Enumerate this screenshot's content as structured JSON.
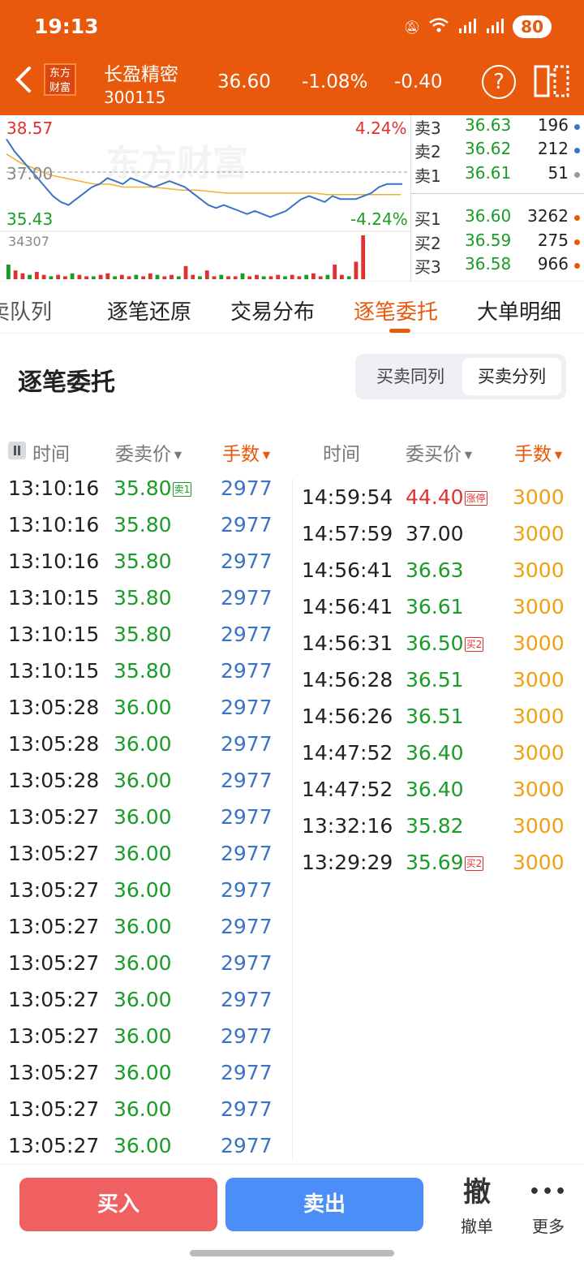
{
  "status": {
    "time": "19:13",
    "battery": "80"
  },
  "header": {
    "logo_line1": "东方",
    "logo_line2": "财富",
    "stock_name": "长盈精密",
    "stock_code": "300115",
    "price": "36.60",
    "change_pct": "-1.08%",
    "change": "-0.40"
  },
  "chart": {
    "high_price": "38.57",
    "prev_close": "37.00",
    "low_price": "35.43",
    "high_pct": "4.24%",
    "low_pct": "-4.24%",
    "volume_max": "34307",
    "watermark": "东方财富",
    "price_line": [
      38.1,
      37.7,
      37.4,
      37.1,
      36.8,
      36.5,
      36.2,
      36.0,
      35.9,
      36.1,
      36.3,
      36.5,
      36.6,
      36.8,
      36.7,
      36.6,
      36.8,
      36.7,
      36.6,
      36.5,
      36.6,
      36.7,
      36.6,
      36.5,
      36.3,
      36.1,
      35.9,
      35.8,
      35.9,
      35.8,
      35.7,
      35.6,
      35.7,
      35.6,
      35.5,
      35.6,
      35.7,
      35.9,
      36.1,
      36.2,
      36.1,
      36.0,
      36.2,
      36.1,
      36.1,
      36.1,
      36.2,
      36.3,
      36.5,
      36.6,
      36.6,
      36.6
    ],
    "avg_line": [
      37.6,
      37.3,
      37.1,
      36.9,
      36.8,
      36.7,
      36.6,
      36.6,
      36.5,
      36.5,
      36.5,
      36.45,
      36.4,
      36.4,
      36.35,
      36.3,
      36.3,
      36.3,
      36.3,
      36.3,
      36.3,
      36.3,
      36.25,
      36.25,
      36.25,
      36.25,
      36.25,
      36.25
    ],
    "volumes": [
      10,
      6,
      4,
      3,
      5,
      3,
      2,
      3,
      2,
      4,
      3,
      2,
      2,
      3,
      4,
      2,
      3,
      2,
      3,
      2,
      4,
      3,
      2,
      3,
      2,
      9,
      3,
      2,
      6,
      2,
      3,
      2,
      2,
      4,
      2,
      3,
      2,
      2,
      3,
      2,
      3,
      2,
      3,
      4,
      2,
      3,
      10,
      3,
      2,
      12,
      30
    ]
  },
  "orderbook": {
    "rows": [
      {
        "label": "卖3",
        "price": "36.63",
        "vol": "196",
        "dot": "#3b73c6"
      },
      {
        "label": "卖2",
        "price": "36.62",
        "vol": "212",
        "dot": "#3b73c6"
      },
      {
        "label": "卖1",
        "price": "36.61",
        "vol": "51",
        "dot": "#999999"
      },
      {
        "label": "买1",
        "price": "36.60",
        "vol": "3262",
        "dot": "#e8590c"
      },
      {
        "label": "买2",
        "price": "36.59",
        "vol": "275",
        "dot": "#e8590c"
      },
      {
        "label": "买3",
        "price": "36.58",
        "vol": "966",
        "dot": "#e8590c"
      }
    ]
  },
  "tabs": [
    "卖队列",
    "逐笔还原",
    "交易分布",
    "逐笔委托",
    "大单明细"
  ],
  "section": {
    "title": "逐笔委托",
    "toggle_same": "买卖同列",
    "toggle_split": "买卖分列"
  },
  "columns": {
    "left_time": "时间",
    "left_price": "委卖价",
    "left_vol": "手数",
    "right_time": "时间",
    "right_price": "委买价",
    "right_vol": "手数"
  },
  "sell_orders": [
    {
      "time": "13:10:16",
      "price": "35.80",
      "tag": "卖1",
      "vol": "2977"
    },
    {
      "time": "13:10:16",
      "price": "35.80",
      "tag": "",
      "vol": "2977"
    },
    {
      "time": "13:10:16",
      "price": "35.80",
      "tag": "",
      "vol": "2977"
    },
    {
      "time": "13:10:15",
      "price": "35.80",
      "tag": "",
      "vol": "2977"
    },
    {
      "time": "13:10:15",
      "price": "35.80",
      "tag": "",
      "vol": "2977"
    },
    {
      "time": "13:10:15",
      "price": "35.80",
      "tag": "",
      "vol": "2977"
    },
    {
      "time": "13:05:28",
      "price": "36.00",
      "tag": "",
      "vol": "2977"
    },
    {
      "time": "13:05:28",
      "price": "36.00",
      "tag": "",
      "vol": "2977"
    },
    {
      "time": "13:05:28",
      "price": "36.00",
      "tag": "",
      "vol": "2977"
    },
    {
      "time": "13:05:27",
      "price": "36.00",
      "tag": "",
      "vol": "2977"
    },
    {
      "time": "13:05:27",
      "price": "36.00",
      "tag": "",
      "vol": "2977"
    },
    {
      "time": "13:05:27",
      "price": "36.00",
      "tag": "",
      "vol": "2977"
    },
    {
      "time": "13:05:27",
      "price": "36.00",
      "tag": "",
      "vol": "2977"
    },
    {
      "time": "13:05:27",
      "price": "36.00",
      "tag": "",
      "vol": "2977"
    },
    {
      "time": "13:05:27",
      "price": "36.00",
      "tag": "",
      "vol": "2977"
    },
    {
      "time": "13:05:27",
      "price": "36.00",
      "tag": "",
      "vol": "2977"
    },
    {
      "time": "13:05:27",
      "price": "36.00",
      "tag": "",
      "vol": "2977"
    },
    {
      "time": "13:05:27",
      "price": "36.00",
      "tag": "",
      "vol": "2977"
    },
    {
      "time": "13:05:27",
      "price": "36.00",
      "tag": "",
      "vol": "2977"
    }
  ],
  "buy_orders": [
    {
      "time": "14:59:54",
      "price": "44.40",
      "tag": "涨停",
      "vol": "3000",
      "color": "#e03131"
    },
    {
      "time": "14:57:59",
      "price": "37.00",
      "tag": "",
      "vol": "3000",
      "color": "#222222"
    },
    {
      "time": "14:56:41",
      "price": "36.63",
      "tag": "",
      "vol": "3000",
      "color": "#1a9c28"
    },
    {
      "time": "14:56:41",
      "price": "36.61",
      "tag": "",
      "vol": "3000",
      "color": "#1a9c28"
    },
    {
      "time": "14:56:31",
      "price": "36.50",
      "tag": "买2",
      "vol": "3000",
      "color": "#1a9c28"
    },
    {
      "time": "14:56:28",
      "price": "36.51",
      "tag": "",
      "vol": "3000",
      "color": "#1a9c28"
    },
    {
      "time": "14:56:26",
      "price": "36.51",
      "tag": "",
      "vol": "3000",
      "color": "#1a9c28"
    },
    {
      "time": "14:47:52",
      "price": "36.40",
      "tag": "",
      "vol": "3000",
      "color": "#1a9c28"
    },
    {
      "time": "14:47:52",
      "price": "36.40",
      "tag": "",
      "vol": "3000",
      "color": "#1a9c28"
    },
    {
      "time": "13:32:16",
      "price": "35.82",
      "tag": "",
      "vol": "3000",
      "color": "#1a9c28"
    },
    {
      "time": "13:29:29",
      "price": "35.69",
      "tag": "买2",
      "vol": "3000",
      "color": "#1a9c28"
    }
  ],
  "bottom": {
    "buy": "买入",
    "sell": "卖出",
    "cancel_glyph": "撤",
    "cancel_label": "撤单",
    "more_glyph": "•••",
    "more_label": "更多"
  },
  "colors": {
    "accent": "#e8590c",
    "up": "#e03131",
    "down": "#1a9c28",
    "blue_vol": "#3b73c6",
    "orange_vol": "#f0a010"
  }
}
